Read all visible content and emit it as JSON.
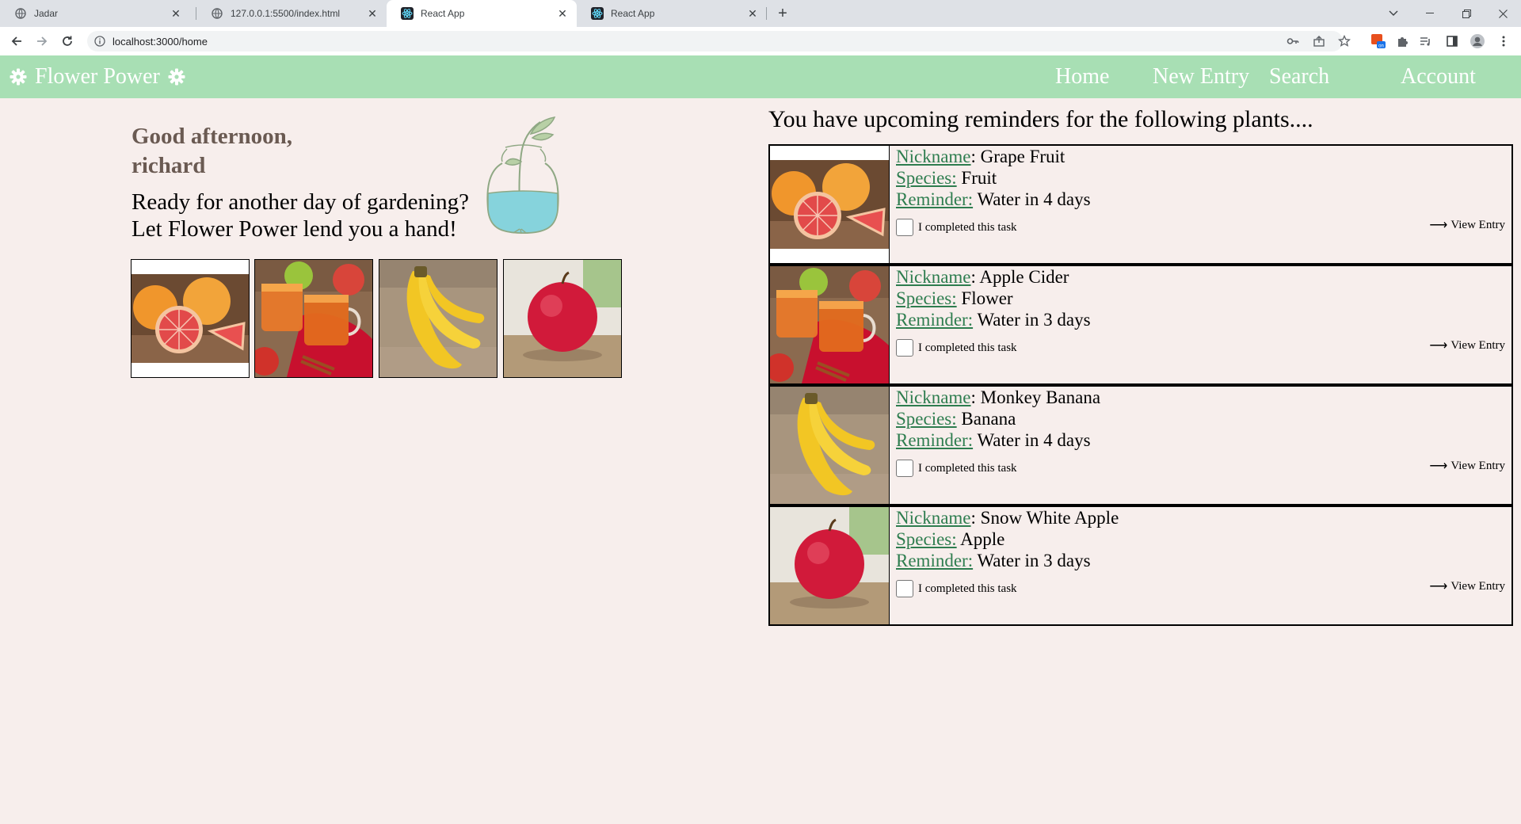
{
  "browser": {
    "tabs": [
      {
        "label": "Jadar",
        "icon": "globe-icon"
      },
      {
        "label": "127.0.0.1:5500/index.html",
        "icon": "globe-icon"
      },
      {
        "label": "React App",
        "icon": "react-icon"
      },
      {
        "label": "React App",
        "icon": "react-icon"
      }
    ],
    "url": "localhost:3000/home"
  },
  "navbar": {
    "brand": "Flower Power",
    "links": [
      "Home",
      "New Entry",
      "Search",
      "Account"
    ],
    "color": "#a8dfb4"
  },
  "home": {
    "greeting_line1": "Good afternoon,",
    "greeting_line2": "richard",
    "tagline_line1": "Ready for another day of gardening?",
    "tagline_line2": "Let Flower Power lend you a hand!",
    "gallery": [
      "grapefruit",
      "apple-cider",
      "banana",
      "apple"
    ]
  },
  "reminders": {
    "heading": "You have upcoming reminders for the following plants....",
    "labels": {
      "nickname": "Nickname",
      "species": "Species:",
      "reminder": "Reminder:",
      "task": "I completed this task",
      "view": "View Entry"
    },
    "items": [
      {
        "nickname": "Grape Fruit",
        "species": "Fruit",
        "reminder": "Water in 4 days",
        "image": "grapefruit"
      },
      {
        "nickname": "Apple Cider",
        "species": "Flower",
        "reminder": "Water in 3 days",
        "image": "apple-cider"
      },
      {
        "nickname": "Monkey Banana",
        "species": "Banana",
        "reminder": "Water in 4 days",
        "image": "banana"
      },
      {
        "nickname": "Snow White Apple",
        "species": "Apple",
        "reminder": "Water in 3 days",
        "image": "apple"
      }
    ]
  },
  "colors": {
    "page_bg": "#f7eeec",
    "label_green": "#2e7d4f",
    "greeting_brown": "#6a5a52"
  }
}
